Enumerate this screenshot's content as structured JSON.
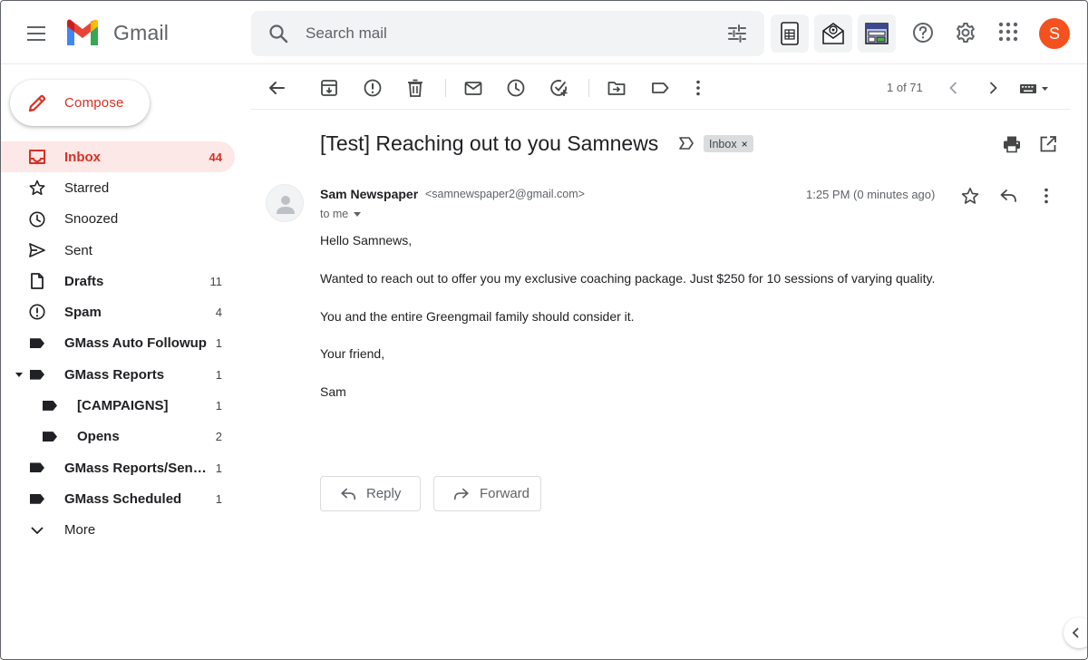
{
  "header": {
    "app_name": "Gmail",
    "search_placeholder": "Search mail",
    "avatar_initial": "S",
    "addon_icons": [
      "spreadsheet-icon",
      "mail-tracking-icon",
      "template-icon"
    ],
    "icons": [
      "help-icon",
      "settings-icon",
      "apps-grid-icon"
    ]
  },
  "sidebar": {
    "compose_label": "Compose",
    "items": [
      {
        "label": "Inbox",
        "count": "44",
        "icon": "inbox-icon",
        "active": true
      },
      {
        "label": "Starred",
        "count": "",
        "icon": "star-icon"
      },
      {
        "label": "Snoozed",
        "count": "",
        "icon": "clock-icon"
      },
      {
        "label": "Sent",
        "count": "",
        "icon": "send-icon"
      },
      {
        "label": "Drafts",
        "count": "11",
        "icon": "draft-icon",
        "bold": true
      },
      {
        "label": "Spam",
        "count": "4",
        "icon": "spam-icon",
        "bold": true
      },
      {
        "label": "GMass Auto Followup",
        "count": "1",
        "icon": "label-icon",
        "bold": true
      },
      {
        "label": "GMass Reports",
        "count": "1",
        "icon": "label-icon",
        "bold": true,
        "expanded": true
      },
      {
        "label": "[CAMPAIGNS]",
        "count": "1",
        "icon": "label-icon",
        "bold": true,
        "sub": true
      },
      {
        "label": "Opens",
        "count": "2",
        "icon": "label-icon",
        "bold": true,
        "sub": true
      },
      {
        "label": "GMass Reports/Sen…",
        "count": "1",
        "icon": "label-icon",
        "bold": true
      },
      {
        "label": "GMass Scheduled",
        "count": "1",
        "icon": "label-icon",
        "bold": true
      },
      {
        "label": "More",
        "count": "",
        "icon": "chevron-down-icon"
      }
    ]
  },
  "toolbar": {
    "pager_text": "1 of 71"
  },
  "message": {
    "subject": "[Test] Reaching out to you Samnews",
    "label_chip": "Inbox",
    "chip_close": "×",
    "sender_name": "Sam Newspaper",
    "sender_email": "<samnewspaper2@gmail.com>",
    "recipient_text": "to me",
    "time": "1:25 PM (0 minutes ago)",
    "body": [
      "Hello Samnews,",
      "Wanted to reach out to offer you my exclusive coaching package. Just $250 for 10 sessions of varying quality.",
      "You and the entire Greengmail family should consider it.",
      "Your friend,",
      "Sam"
    ],
    "reply_label": "Reply",
    "forward_label": "Forward"
  },
  "colors": {
    "accent": "#d93025",
    "active_bg": "#fce8e6",
    "avatar_bg": "#f4511e"
  }
}
